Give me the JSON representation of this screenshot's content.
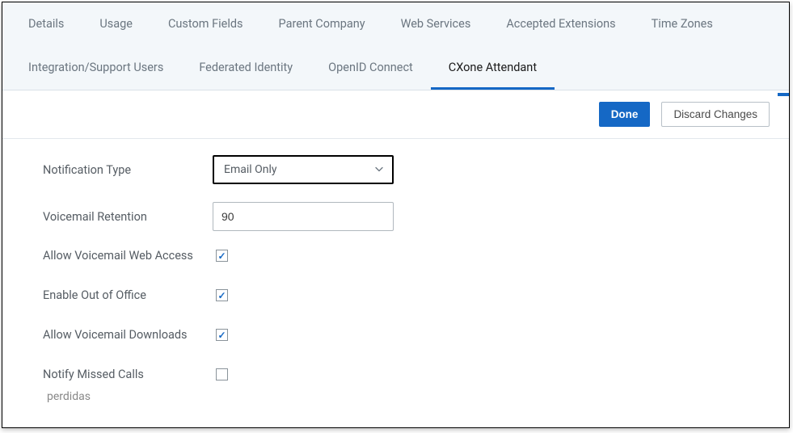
{
  "tabs": {
    "row1": [
      {
        "label": "Details"
      },
      {
        "label": "Usage"
      },
      {
        "label": "Custom Fields"
      },
      {
        "label": "Parent Company"
      },
      {
        "label": "Web Services"
      },
      {
        "label": "Accepted Extensions"
      },
      {
        "label": "Time Zones"
      }
    ],
    "row2": [
      {
        "label": "Integration/Support Users"
      },
      {
        "label": "Federated Identity"
      },
      {
        "label": "OpenID Connect"
      },
      {
        "label": "CXone Attendant",
        "active": true
      }
    ]
  },
  "actions": {
    "done": "Done",
    "discard": "Discard Changes"
  },
  "form": {
    "notification_type": {
      "label": "Notification Type",
      "value": "Email Only"
    },
    "voicemail_retention": {
      "label": "Voicemail Retention",
      "value": "90"
    },
    "allow_web_access": {
      "label": "Allow Voicemail Web Access",
      "checked": true
    },
    "enable_ooo": {
      "label": "Enable Out of Office",
      "checked": true
    },
    "allow_downloads": {
      "label": "Allow Voicemail Downloads",
      "checked": true
    },
    "notify_missed": {
      "label": "Notify Missed Calls",
      "checked": false
    }
  },
  "cutoff_text": "perdidas"
}
